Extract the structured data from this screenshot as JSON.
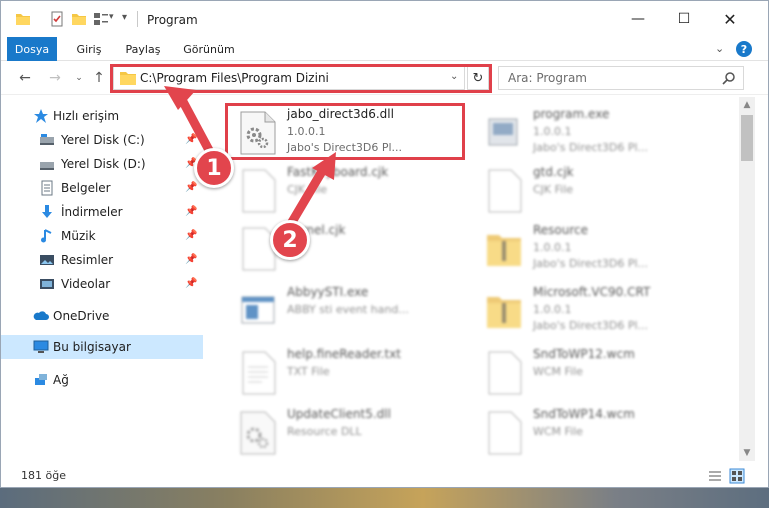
{
  "title": "Program",
  "ribbon": {
    "tabs": [
      "Dosya",
      "Giriş",
      "Paylaş",
      "Görünüm"
    ],
    "help": "?"
  },
  "nav": {
    "address": "C:\\Program Files\\Program Dizini",
    "search_placeholder": "Ara: Program"
  },
  "sidebar": {
    "items": [
      {
        "label": "Hızlı erişim",
        "icon": "star-icon"
      },
      {
        "label": "Yerel Disk (C:)",
        "icon": "drive-icon"
      },
      {
        "label": "Yerel Disk (D:)",
        "icon": "drive-icon"
      },
      {
        "label": "Belgeler",
        "icon": "documents-icon"
      },
      {
        "label": "İndirmeler",
        "icon": "download-icon"
      },
      {
        "label": "Müzik",
        "icon": "music-icon"
      },
      {
        "label": "Resimler",
        "icon": "pictures-icon"
      },
      {
        "label": "Videolar",
        "icon": "videos-icon"
      },
      {
        "label": "OneDrive",
        "icon": "cloud-icon"
      },
      {
        "label": "Bu bilgisayar",
        "icon": "computer-icon"
      },
      {
        "label": "Ağ",
        "icon": "network-icon"
      }
    ]
  },
  "files": [
    {
      "name": "jabo_direct3d6.dll",
      "line2": "1.0.0.1",
      "line3": "Jabo's Direct3D6 Pl...",
      "icon": "dll-gear-icon"
    },
    {
      "name": "program.exe",
      "line2": "1.0.0.1",
      "line3": "Jabo's Direct3D6 Pl...",
      "icon": "exe-icon"
    },
    {
      "name": "FastKeyboard.cjk",
      "line2": "CJK File",
      "line3": "",
      "icon": "blank-file-icon"
    },
    {
      "name": "gtd.cjk",
      "line2": "CJK File",
      "line3": "",
      "icon": "blank-file-icon"
    },
    {
      "name": "Kernel.cjk",
      "line2": "",
      "line3": "",
      "icon": "blank-file-icon"
    },
    {
      "name": "Resource",
      "line2": "1.0.0.1",
      "line3": "Jabo's Direct3D6 Pl...",
      "icon": "zip-folder-icon"
    },
    {
      "name": "AbbyySTI.exe",
      "line2": "ABBY sti event hand...",
      "line3": "",
      "icon": "exe-window-icon"
    },
    {
      "name": "Microsoft.VC90.CRT",
      "line2": "1.0.0.1",
      "line3": "Jabo's Direct3D6 Pl...",
      "icon": "zip-folder-icon"
    },
    {
      "name": "help.fineReader.txt",
      "line2": "TXT File",
      "line3": "",
      "icon": "text-file-icon"
    },
    {
      "name": "SndToWP12.wcm",
      "line2": "WCM File",
      "line3": "",
      "icon": "blank-file-icon"
    },
    {
      "name": "UpdateClient5.dll",
      "line2": "Resource DLL",
      "line3": "",
      "icon": "dll-gear-icon"
    },
    {
      "name": "SndToWP14.wcm",
      "line2": "WCM File",
      "line3": "",
      "icon": "blank-file-icon"
    }
  ],
  "status": {
    "count": "181 öğe"
  },
  "steps": [
    "1",
    "2"
  ],
  "colors": {
    "accent": "#1979ca",
    "highlight": "#e0404a",
    "selection": "#cce8ff"
  }
}
